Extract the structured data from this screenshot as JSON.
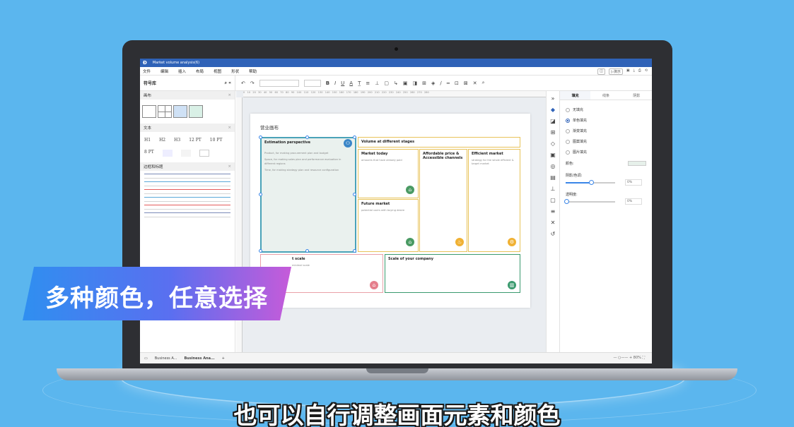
{
  "app": {
    "logo": "Ð",
    "window_title": "Market volume analysis(6)",
    "menu": [
      "文件",
      "编辑",
      "插入",
      "布局",
      "视图",
      "形状",
      "帮助"
    ],
    "present_label": "演示"
  },
  "library": {
    "title": "符号库",
    "sections": {
      "canvas": "画布",
      "text": "文本",
      "borders": "边框和标题",
      "sticky": "贴纸"
    },
    "text_samples": [
      "H1",
      "H2",
      "H3",
      "12 PT",
      "10 PT"
    ],
    "text_small": "8 PT"
  },
  "toolbar": {
    "bold": "B",
    "italic": "I",
    "underline": "U",
    "font_color": "A"
  },
  "canvas": {
    "page_title": "营业画布",
    "cards": {
      "estimation": {
        "title": "Estimation perspective",
        "lines": [
          "Product, for making procurement plan and budget",
          "Space, for making sales plan and performance evaluation in different regions",
          "Time, for making strategy plan and resource configuration"
        ]
      },
      "volume": {
        "title": "Volume at different stages"
      },
      "market_today": {
        "title": "Market today",
        "text": "amounts that have already paid"
      },
      "affordable": {
        "title": "Affordable price & Accessible channels"
      },
      "efficient": {
        "title": "Efficient market",
        "text": "strategy for the whole efficient & target market"
      },
      "future": {
        "title": "Future market",
        "text": "potential users with buying desire"
      },
      "market_scale": {
        "title": "t scale",
        "text": "minimal scale"
      },
      "company_scale": {
        "title": "Scale of your company"
      }
    }
  },
  "pages": {
    "tab1": "Business A...",
    "tab2": "Business Ana...",
    "zoom": "80%"
  },
  "properties": {
    "tabs": [
      "填充",
      "线条",
      "阴影"
    ],
    "fill_options": [
      "无填充",
      "单色填充",
      "渐变填充",
      "图案填充",
      "图片填充"
    ],
    "selected_option": 1,
    "color_label": "颜色:",
    "shade_label": "阴影/色调:",
    "shade_value": "0%",
    "transparency_label": "透明度:",
    "transparency_value": "0%"
  },
  "overlay": {
    "banner": "多种颜色，任意选择",
    "subtitle": "也可以自行调整画面元素和颜色"
  },
  "colors": {
    "background": "#5bb6ee",
    "titlebar": "#2f62b7",
    "card_teal": "#4aa3b8",
    "card_yellow": "#e8c35a",
    "card_pink": "#e9a0a8",
    "card_green": "#3a9a6e",
    "badge_green": "#4a9a63",
    "badge_orange": "#f0b133",
    "badge_pink": "#e57f8c"
  }
}
